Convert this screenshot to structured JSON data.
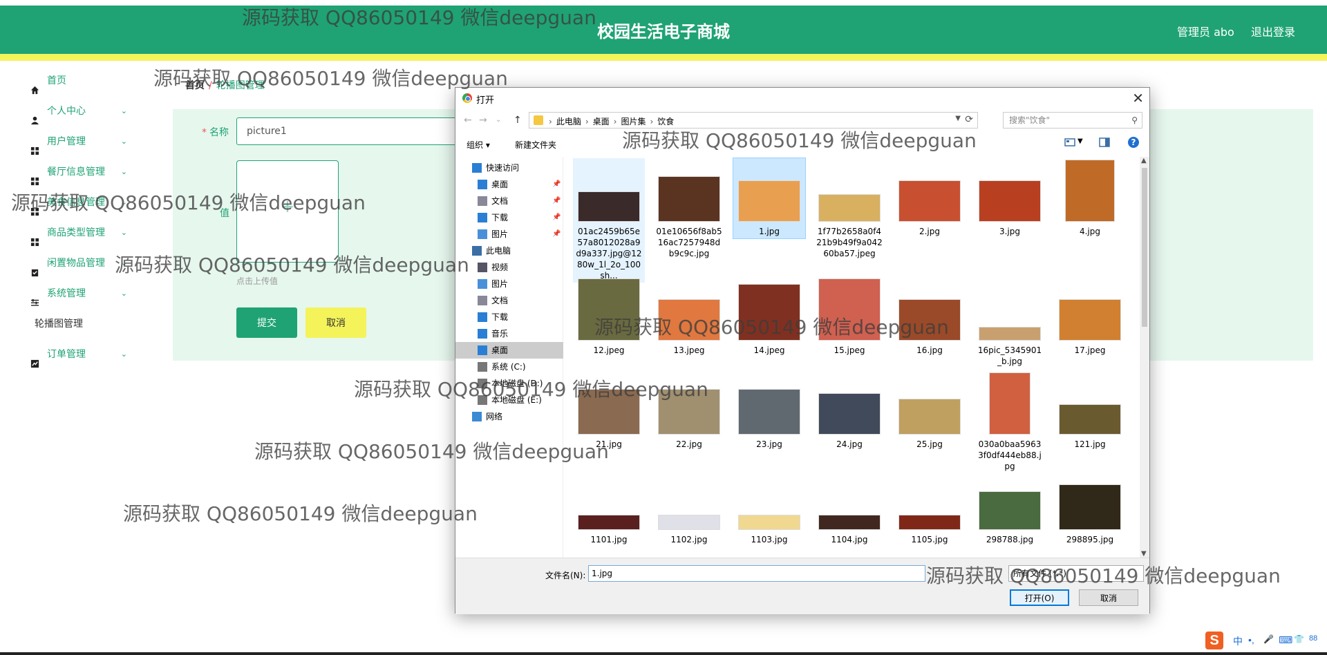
{
  "header": {
    "title": "校园生活电子商城",
    "admin": "管理员 abo",
    "logout": "退出登录"
  },
  "sidebar": {
    "items": [
      {
        "label": "首页",
        "icon": "home-icon",
        "chev": false
      },
      {
        "label": "个人中心",
        "icon": "user-icon",
        "chev": true
      },
      {
        "label": "用户管理",
        "icon": "grid-icon",
        "chev": true
      },
      {
        "label": "餐厅信息管理",
        "icon": "grid-icon",
        "chev": true
      },
      {
        "label": "美食信息管理",
        "icon": "grid-icon",
        "chev": true
      },
      {
        "label": "商品类型管理",
        "icon": "grid-icon",
        "chev": true
      },
      {
        "label": "闲置物品管理",
        "icon": "clipboard-icon",
        "chev": true
      },
      {
        "label": "系统管理",
        "icon": "sliders-icon",
        "chev": true
      }
    ],
    "sub_item": "轮播图管理",
    "order": {
      "label": "订单管理",
      "icon": "chart-icon"
    },
    "chevron": "⌄"
  },
  "breadcrumb": {
    "home": "首页",
    "sep": "/",
    "current": "轮播图管理"
  },
  "form": {
    "name_label": "名称",
    "required_mark": "*",
    "name_value": "picture1",
    "value_label": "值",
    "upload_plus": "+",
    "upload_hint": "点击上传值",
    "submit": "提交",
    "cancel": "取消"
  },
  "dialog": {
    "title": "打开",
    "close": "✕",
    "nav": {
      "back": "←",
      "forward": "→",
      "recent": "⌄",
      "up": "↑"
    },
    "path": [
      "此电脑",
      "桌面",
      "图片集",
      "饮食"
    ],
    "path_sep": "›",
    "search_placeholder": "搜索\"饮食\"",
    "toolbar": {
      "organize": "组织 ▾",
      "new_folder": "新建文件夹"
    },
    "nav_pane": [
      {
        "label": "快速访问",
        "icon": "star-icon",
        "pin": false,
        "indent": 0
      },
      {
        "label": "桌面",
        "icon": "desktop-icon",
        "pin": true,
        "indent": 1
      },
      {
        "label": "文档",
        "icon": "doc-icon",
        "pin": true,
        "indent": 1
      },
      {
        "label": "下载",
        "icon": "download-icon",
        "pin": true,
        "indent": 1
      },
      {
        "label": "图片",
        "icon": "picture-icon",
        "pin": true,
        "indent": 1
      },
      {
        "label": "此电脑",
        "icon": "computer-icon",
        "pin": false,
        "indent": 0
      },
      {
        "label": "视频",
        "icon": "video-icon",
        "pin": false,
        "indent": 1
      },
      {
        "label": "图片",
        "icon": "picture-icon",
        "pin": false,
        "indent": 1
      },
      {
        "label": "文档",
        "icon": "doc-icon",
        "pin": false,
        "indent": 1
      },
      {
        "label": "下载",
        "icon": "download-icon",
        "pin": false,
        "indent": 1
      },
      {
        "label": "音乐",
        "icon": "music-icon",
        "pin": false,
        "indent": 1
      },
      {
        "label": "桌面",
        "icon": "desktop-icon",
        "pin": false,
        "indent": 1,
        "selected": true
      },
      {
        "label": "系统 (C:)",
        "icon": "drive-icon",
        "pin": false,
        "indent": 1
      },
      {
        "label": "本地磁盘 (D:)",
        "icon": "drive-icon",
        "pin": false,
        "indent": 1
      },
      {
        "label": "本地磁盘 (E:)",
        "icon": "drive-icon",
        "pin": false,
        "indent": 1
      },
      {
        "label": "网络",
        "icon": "network-icon",
        "pin": false,
        "indent": 0
      }
    ],
    "pin_glyph": "📌",
    "files": [
      {
        "name": "01ac2459b65e57a8012028a9d9a337.jpg@1280w_1l_2o_100sh...",
        "color": "#3a2a2a",
        "state": "hover"
      },
      {
        "name": "01e10656f8ab516ac7257948db9c9c.jpg",
        "color": "#5a3420"
      },
      {
        "name": "1.jpg",
        "color": "#e8a050",
        "state": "selected"
      },
      {
        "name": "1f77b2658a0f421b9b49f9a04260ba57.jpeg",
        "color": "#d8b060"
      },
      {
        "name": "2.jpg",
        "color": "#c85030"
      },
      {
        "name": "3.jpg",
        "color": "#b84020"
      },
      {
        "name": "4.jpg",
        "color": "#c06a28"
      },
      {
        "name": "12.jpeg",
        "color": "#6a6a40"
      },
      {
        "name": "13.jpeg",
        "color": "#e07840"
      },
      {
        "name": "14.jpeg",
        "color": "#803020"
      },
      {
        "name": "15.jpeg",
        "color": "#d06050"
      },
      {
        "name": "16.jpg",
        "color": "#9a4a28"
      },
      {
        "name": "16pic_5345901_b.jpg",
        "color": "#c8a070"
      },
      {
        "name": "17.jpeg",
        "color": "#d08030"
      },
      {
        "name": "21.jpg",
        "color": "#8a6a50"
      },
      {
        "name": "22.jpg",
        "color": "#a09070"
      },
      {
        "name": "23.jpg",
        "color": "#606870"
      },
      {
        "name": "24.jpg",
        "color": "#404a5a"
      },
      {
        "name": "25.jpg",
        "color": "#c0a060"
      },
      {
        "name": "030a0baa59633f0df444eb88.jpg",
        "color": "#d06040"
      },
      {
        "name": "121.jpg",
        "color": "#6a5a30"
      },
      {
        "name": "1101.jpg",
        "color": "#5a2020"
      },
      {
        "name": "1102.jpg",
        "color": "#e0e0e8"
      },
      {
        "name": "1103.jpg",
        "color": "#f0d890"
      },
      {
        "name": "1104.jpg",
        "color": "#402820"
      },
      {
        "name": "1105.jpg",
        "color": "#802818"
      },
      {
        "name": "298788.jpg",
        "color": "#4a6a40"
      },
      {
        "name": "298895.jpg",
        "color": "#302818"
      },
      {
        "name": "",
        "color": "#e09070"
      },
      {
        "name": "",
        "color": "#a03020"
      },
      {
        "name": "",
        "color": "#909070"
      },
      {
        "name": "",
        "color": "#c0c0a0"
      },
      {
        "name": "",
        "color": "#b04030"
      },
      {
        "name": "",
        "color": "#c0c0c0"
      },
      {
        "name": "",
        "color": "#505050"
      }
    ],
    "filename_label": "文件名(N):",
    "filename_value": "1.jpg",
    "filetype": "所有文件 (*.*)",
    "open": "打开(O)",
    "cancel": "取消"
  },
  "watermark": "源码获取 QQ86050149 微信deepguan",
  "ime": {
    "s": "S",
    "items": [
      "中",
      "•,",
      "🎤",
      "⌨",
      "👕",
      "88"
    ]
  },
  "colors": {
    "primary": "#1fa374",
    "accent_yellow": "#f4f35a",
    "selection": "#cce8ff"
  }
}
